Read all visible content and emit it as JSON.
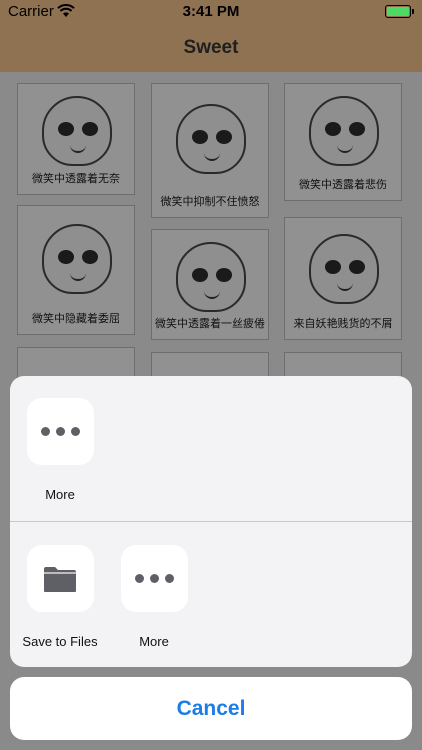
{
  "status_bar": {
    "carrier": "Carrier",
    "time": "3:41 PM"
  },
  "nav": {
    "title": "Sweet"
  },
  "grid": {
    "captions": [
      "微笑中透露着无奈",
      "微笑中抑制不住愤怒",
      "微笑中透露着悲伤",
      "微笑中隐藏着委屈",
      "微笑中透露着一丝疲倦",
      "来自妖艳贱货的不屑"
    ]
  },
  "share_sheet": {
    "row1": [
      {
        "label": "More",
        "icon": "more-icon"
      }
    ],
    "row2": [
      {
        "label": "Save to Files",
        "icon": "folder-icon"
      },
      {
        "label": "More",
        "icon": "more-icon"
      }
    ]
  },
  "cancel_label": "Cancel",
  "colors": {
    "nav_bg": "#8e7252",
    "accent": "#1b7ee6",
    "battery": "#4cd964"
  }
}
